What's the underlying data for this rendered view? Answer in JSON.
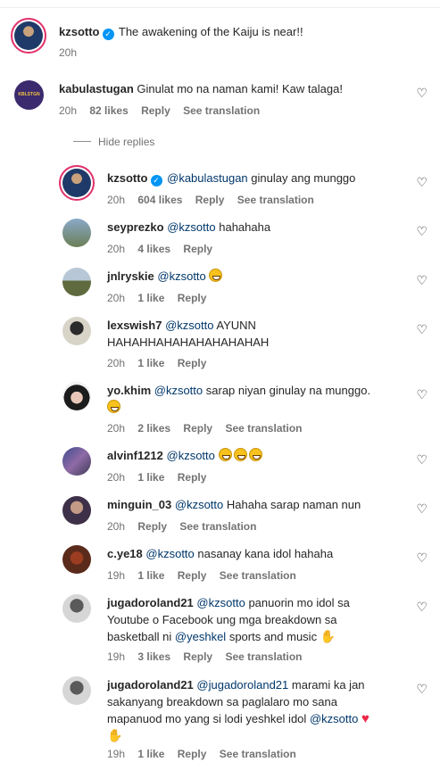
{
  "colors": {
    "accent": "#0095f6",
    "mention": "#00376b",
    "meta": "#737373",
    "ring": "#e1306c"
  },
  "post": {
    "username": "kzsotto",
    "caption": "The awakening of the Kaiju is near!!",
    "time": "20h"
  },
  "comment": {
    "username": "kabulastugan",
    "avatar_text": "KBLSTGN",
    "text": "Ginulat mo na naman kami! Kaw talaga!",
    "time": "20h",
    "likes": "82 likes",
    "reply": "Reply",
    "see_translation": "See translation"
  },
  "hide_replies": "Hide replies",
  "replies": [
    {
      "username": "kzsotto",
      "mention": "@kabulastugan",
      "text": "ginulay ang munggo",
      "time": "20h",
      "likes": "604 likes",
      "reply": "Reply",
      "see_translation": "See translation"
    },
    {
      "username": "seyprezko",
      "mention": "@kzsotto",
      "text": "hahahaha",
      "time": "20h",
      "likes": "4 likes",
      "reply": "Reply"
    },
    {
      "username": "jnlryskie",
      "mention": "@kzsotto",
      "text": "",
      "emoji": "grinning-face",
      "time": "20h",
      "likes": "1 like",
      "reply": "Reply"
    },
    {
      "username": "lexswish7",
      "mention": "@kzsotto",
      "text": "AYUNN",
      "text2": "HAHAHHAHAHAHAHAHAHAH",
      "time": "20h",
      "likes": "1 like",
      "reply": "Reply"
    },
    {
      "username": "yo.khim",
      "mention": "@kzsotto",
      "text": "sarap niyan ginulay na munggo.",
      "emoji": "grinning-face",
      "time": "20h",
      "likes": "2 likes",
      "reply": "Reply",
      "see_translation": "See translation"
    },
    {
      "username": "alvinf1212",
      "mention": "@kzsotto",
      "text": "",
      "emoji": "grinning-face x3",
      "time": "20h",
      "likes": "1 like",
      "reply": "Reply"
    },
    {
      "username": "minguin_03",
      "mention": "@kzsotto",
      "text": "Hahaha sarap naman nun",
      "time": "20h",
      "reply": "Reply",
      "see_translation": "See translation"
    },
    {
      "username": "c.ye18",
      "mention": "@kzsotto",
      "text": "nasanay kana idol hahaha",
      "time": "19h",
      "likes": "1 like",
      "reply": "Reply",
      "see_translation": "See translation"
    },
    {
      "username": "jugadoroland21",
      "mention": "@kzsotto",
      "text": "panuorin mo idol sa",
      "text2": "Youtube o Facebook ung mga breakdown sa",
      "text3_pre": "basketball ni",
      "mention2": "@yeshkel",
      "text3_post": "sports and music",
      "emoji": "clapping-hands",
      "time": "19h",
      "likes": "3 likes",
      "reply": "Reply",
      "see_translation": "See translation"
    },
    {
      "username": "jugadoroland21",
      "mention": "@jugadoroland21",
      "text": "marami ka jan",
      "text2": "sakanyang breakdown sa paglalaro mo sana",
      "text3_pre": "mapanuod mo yang si lodi yeshkel idol",
      "mention2": "@kzsotto",
      "emoji": "red-heart, clapping-hands",
      "time": "19h",
      "likes": "1 like",
      "reply": "Reply",
      "see_translation": "See translation"
    }
  ],
  "icons": {
    "like": "heart-outline-icon",
    "verified": "verified-badge-icon"
  }
}
